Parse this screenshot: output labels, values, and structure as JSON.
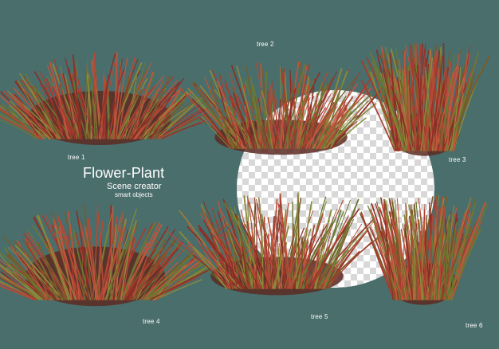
{
  "colors": {
    "background": "#4a6e6c",
    "text": "#ffffff",
    "checker_light": "#ffffff",
    "checker_dark": "#d8d8d8",
    "grass_red": "#a83a2e",
    "grass_green": "#8a8a3a",
    "grass_dark": "#5c2a22"
  },
  "icons": [
    "transparency-checkerboard",
    "grass-bush"
  ],
  "heading": {
    "title": "Flower-Plant",
    "subtitle": "Scene creator",
    "tagline": "smart objects"
  },
  "plants": [
    {
      "name": "tree-1",
      "label": "tree 1",
      "style": "mound"
    },
    {
      "name": "tree-2",
      "label": "tree 2",
      "style": "tuft"
    },
    {
      "name": "tree-3",
      "label": "tree 3",
      "style": "tall"
    },
    {
      "name": "tree-4",
      "label": "tree 4",
      "style": "mound"
    },
    {
      "name": "tree-5",
      "label": "tree 5",
      "style": "tuft"
    },
    {
      "name": "tree-6",
      "label": "tree 6",
      "style": "tall"
    }
  ]
}
